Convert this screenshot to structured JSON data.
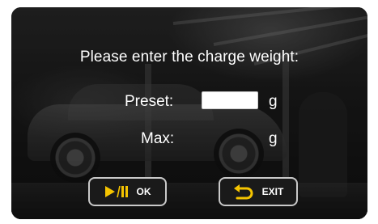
{
  "dialog": {
    "prompt": "Please enter the charge weight:"
  },
  "preset": {
    "label": "Preset:",
    "value": "",
    "unit": "g"
  },
  "max": {
    "label": "Max:",
    "value": "",
    "unit": "g"
  },
  "buttons": {
    "ok": {
      "icon": "play-pause-icon",
      "label": "OK"
    },
    "exit": {
      "icon": "return-arrow-icon",
      "label": "EXIT"
    }
  },
  "colors": {
    "accent_yellow": "#f5c400",
    "text": "#ffffff",
    "button_border": "#c9c9c9"
  }
}
